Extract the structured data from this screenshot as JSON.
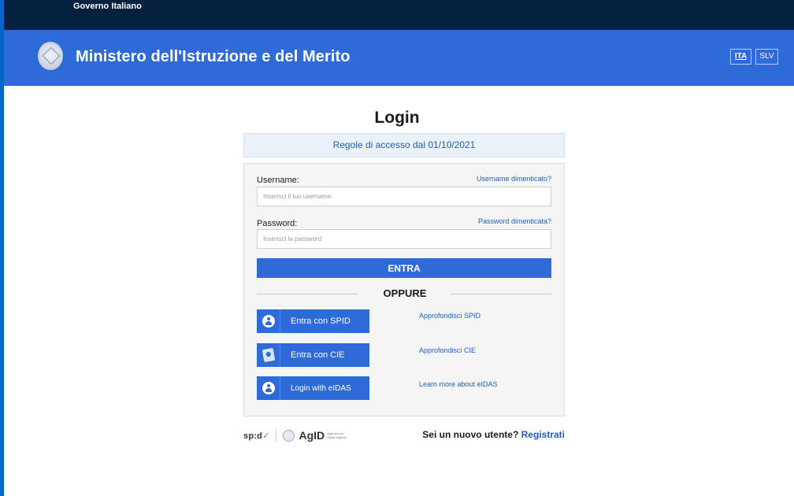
{
  "gov_bar": {
    "text": "Governo Italiano"
  },
  "header": {
    "title": "Ministero dell'Istruzione e del Merito",
    "languages": [
      {
        "label": "ITA",
        "active": true
      },
      {
        "label": "SLV",
        "active": false
      }
    ]
  },
  "login": {
    "title": "Login",
    "rules_link": "Regole di accesso dal 01/10/2021",
    "username": {
      "label": "Username:",
      "placeholder": "Inserisci il tuo username",
      "forgot": "Username dimenticato?"
    },
    "password": {
      "label": "Password:",
      "placeholder": "Inserisci la password",
      "forgot": "Password dimenticata?"
    },
    "submit_label": "ENTRA",
    "divider_label": "OPPURE",
    "providers": [
      {
        "label": "Entra con SPID",
        "icon": "user-icon",
        "info": "Approfondisci SPID"
      },
      {
        "label": "Entra con CIE",
        "icon": "id-card-icon",
        "info": "Approfondisci CIE"
      },
      {
        "label": "Login with eIDAS",
        "icon": "user-icon",
        "info": "Learn more about eIDAS"
      }
    ]
  },
  "footer": {
    "spid_logo": "sp:d",
    "spid_check": "✓",
    "agid_logo": "AgID",
    "agid_subtitle": "Agenzia per l'Italia Digitale",
    "new_user_text": "Sei un nuovo utente?",
    "register_link": "Registrati"
  },
  "colors": {
    "gov_bar": "#06213f",
    "header": "#2f6ad9",
    "primary": "#2f6ad9",
    "link": "#1f5fbf"
  }
}
